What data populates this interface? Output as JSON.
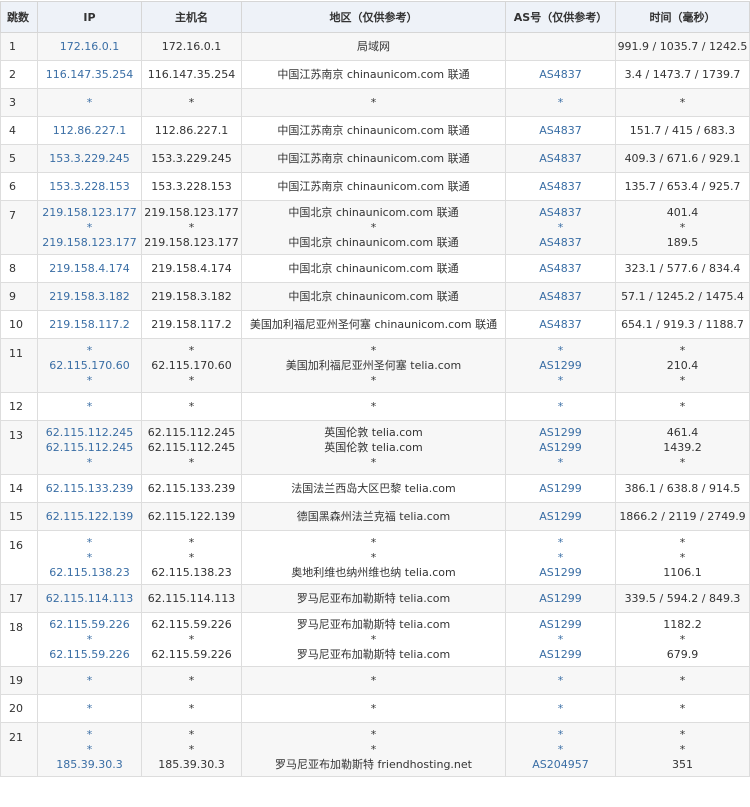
{
  "headers": {
    "hop": "跳数",
    "ip": "IP",
    "host": "主机名",
    "region": "地区（仅供参考）",
    "asn": "AS号（仅供参考）",
    "time": "时间（毫秒）"
  },
  "hops": [
    {
      "hop": "1",
      "ip": [
        "172.16.0.1"
      ],
      "host": [
        "172.16.0.1"
      ],
      "region": [
        "局域网"
      ],
      "asn": [
        ""
      ],
      "time": [
        "991.9 / 1035.7 / 1242.5"
      ]
    },
    {
      "hop": "2",
      "ip": [
        "116.147.35.254"
      ],
      "host": [
        "116.147.35.254"
      ],
      "region": [
        "中国江苏南京 chinaunicom.com 联通"
      ],
      "asn": [
        "AS4837"
      ],
      "time": [
        "3.4 / 1473.7 / 1739.7"
      ]
    },
    {
      "hop": "3",
      "ip": [
        "*"
      ],
      "host": [
        "*"
      ],
      "region": [
        "*"
      ],
      "asn": [
        "*"
      ],
      "time": [
        "*"
      ]
    },
    {
      "hop": "4",
      "ip": [
        "112.86.227.1"
      ],
      "host": [
        "112.86.227.1"
      ],
      "region": [
        "中国江苏南京 chinaunicom.com 联通"
      ],
      "asn": [
        "AS4837"
      ],
      "time": [
        "151.7 / 415 / 683.3"
      ]
    },
    {
      "hop": "5",
      "ip": [
        "153.3.229.245"
      ],
      "host": [
        "153.3.229.245"
      ],
      "region": [
        "中国江苏南京 chinaunicom.com 联通"
      ],
      "asn": [
        "AS4837"
      ],
      "time": [
        "409.3 / 671.6 / 929.1"
      ]
    },
    {
      "hop": "6",
      "ip": [
        "153.3.228.153"
      ],
      "host": [
        "153.3.228.153"
      ],
      "region": [
        "中国江苏南京 chinaunicom.com 联通"
      ],
      "asn": [
        "AS4837"
      ],
      "time": [
        "135.7 / 653.4 / 925.7"
      ]
    },
    {
      "hop": "7",
      "ip": [
        "219.158.123.177",
        "*",
        "219.158.123.177"
      ],
      "host": [
        "219.158.123.177",
        "*",
        "219.158.123.177"
      ],
      "region": [
        "中国北京 chinaunicom.com 联通",
        "*",
        "中国北京 chinaunicom.com 联通"
      ],
      "asn": [
        "AS4837",
        "*",
        "AS4837"
      ],
      "time": [
        "401.4",
        "*",
        "189.5"
      ]
    },
    {
      "hop": "8",
      "ip": [
        "219.158.4.174"
      ],
      "host": [
        "219.158.4.174"
      ],
      "region": [
        "中国北京 chinaunicom.com 联通"
      ],
      "asn": [
        "AS4837"
      ],
      "time": [
        "323.1 / 577.6 / 834.4"
      ]
    },
    {
      "hop": "9",
      "ip": [
        "219.158.3.182"
      ],
      "host": [
        "219.158.3.182"
      ],
      "region": [
        "中国北京 chinaunicom.com 联通"
      ],
      "asn": [
        "AS4837"
      ],
      "time": [
        "57.1 / 1245.2 / 1475.4"
      ]
    },
    {
      "hop": "10",
      "ip": [
        "219.158.117.2"
      ],
      "host": [
        "219.158.117.2"
      ],
      "region": [
        "美国加利福尼亚州圣何塞 chinaunicom.com 联通"
      ],
      "asn": [
        "AS4837"
      ],
      "time": [
        "654.1 / 919.3 / 1188.7"
      ]
    },
    {
      "hop": "11",
      "ip": [
        "*",
        "62.115.170.60",
        "*"
      ],
      "host": [
        "*",
        "62.115.170.60",
        "*"
      ],
      "region": [
        "*",
        "美国加利福尼亚州圣何塞 telia.com",
        "*"
      ],
      "asn": [
        "*",
        "AS1299",
        "*"
      ],
      "time": [
        "*",
        "210.4",
        "*"
      ]
    },
    {
      "hop": "12",
      "ip": [
        "*"
      ],
      "host": [
        "*"
      ],
      "region": [
        "*"
      ],
      "asn": [
        "*"
      ],
      "time": [
        "*"
      ]
    },
    {
      "hop": "13",
      "ip": [
        "62.115.112.245",
        "62.115.112.245",
        "*"
      ],
      "host": [
        "62.115.112.245",
        "62.115.112.245",
        "*"
      ],
      "region": [
        "英国伦敦 telia.com",
        "英国伦敦 telia.com",
        "*"
      ],
      "asn": [
        "AS1299",
        "AS1299",
        "*"
      ],
      "time": [
        "461.4",
        "1439.2",
        "*"
      ]
    },
    {
      "hop": "14",
      "ip": [
        "62.115.133.239"
      ],
      "host": [
        "62.115.133.239"
      ],
      "region": [
        "法国法兰西岛大区巴黎 telia.com"
      ],
      "asn": [
        "AS1299"
      ],
      "time": [
        "386.1 / 638.8 / 914.5"
      ]
    },
    {
      "hop": "15",
      "ip": [
        "62.115.122.139"
      ],
      "host": [
        "62.115.122.139"
      ],
      "region": [
        "德国黑森州法兰克福 telia.com"
      ],
      "asn": [
        "AS1299"
      ],
      "time": [
        "1866.2 / 2119 / 2749.9"
      ]
    },
    {
      "hop": "16",
      "ip": [
        "*",
        "*",
        "62.115.138.23"
      ],
      "host": [
        "*",
        "*",
        "62.115.138.23"
      ],
      "region": [
        "*",
        "*",
        "奥地利维也纳州维也纳 telia.com"
      ],
      "asn": [
        "*",
        "*",
        "AS1299"
      ],
      "time": [
        "*",
        "*",
        "1106.1"
      ]
    },
    {
      "hop": "17",
      "ip": [
        "62.115.114.113"
      ],
      "host": [
        "62.115.114.113"
      ],
      "region": [
        "罗马尼亚布加勒斯特 telia.com"
      ],
      "asn": [
        "AS1299"
      ],
      "time": [
        "339.5 / 594.2 / 849.3"
      ]
    },
    {
      "hop": "18",
      "ip": [
        "62.115.59.226",
        "*",
        "62.115.59.226"
      ],
      "host": [
        "62.115.59.226",
        "*",
        "62.115.59.226"
      ],
      "region": [
        "罗马尼亚布加勒斯特 telia.com",
        "*",
        "罗马尼亚布加勒斯特 telia.com"
      ],
      "asn": [
        "AS1299",
        "*",
        "AS1299"
      ],
      "time": [
        "1182.2",
        "*",
        "679.9"
      ]
    },
    {
      "hop": "19",
      "ip": [
        "*"
      ],
      "host": [
        "*"
      ],
      "region": [
        "*"
      ],
      "asn": [
        "*"
      ],
      "time": [
        "*"
      ]
    },
    {
      "hop": "20",
      "ip": [
        "*"
      ],
      "host": [
        "*"
      ],
      "region": [
        "*"
      ],
      "asn": [
        "*"
      ],
      "time": [
        "*"
      ]
    },
    {
      "hop": "21",
      "ip": [
        "*",
        "*",
        "185.39.30.3"
      ],
      "host": [
        "*",
        "*",
        "185.39.30.3"
      ],
      "region": [
        "*",
        "*",
        "罗马尼亚布加勒斯特 friendhosting.net"
      ],
      "asn": [
        "*",
        "*",
        "AS204957"
      ],
      "time": [
        "*",
        "*",
        "351"
      ]
    }
  ]
}
